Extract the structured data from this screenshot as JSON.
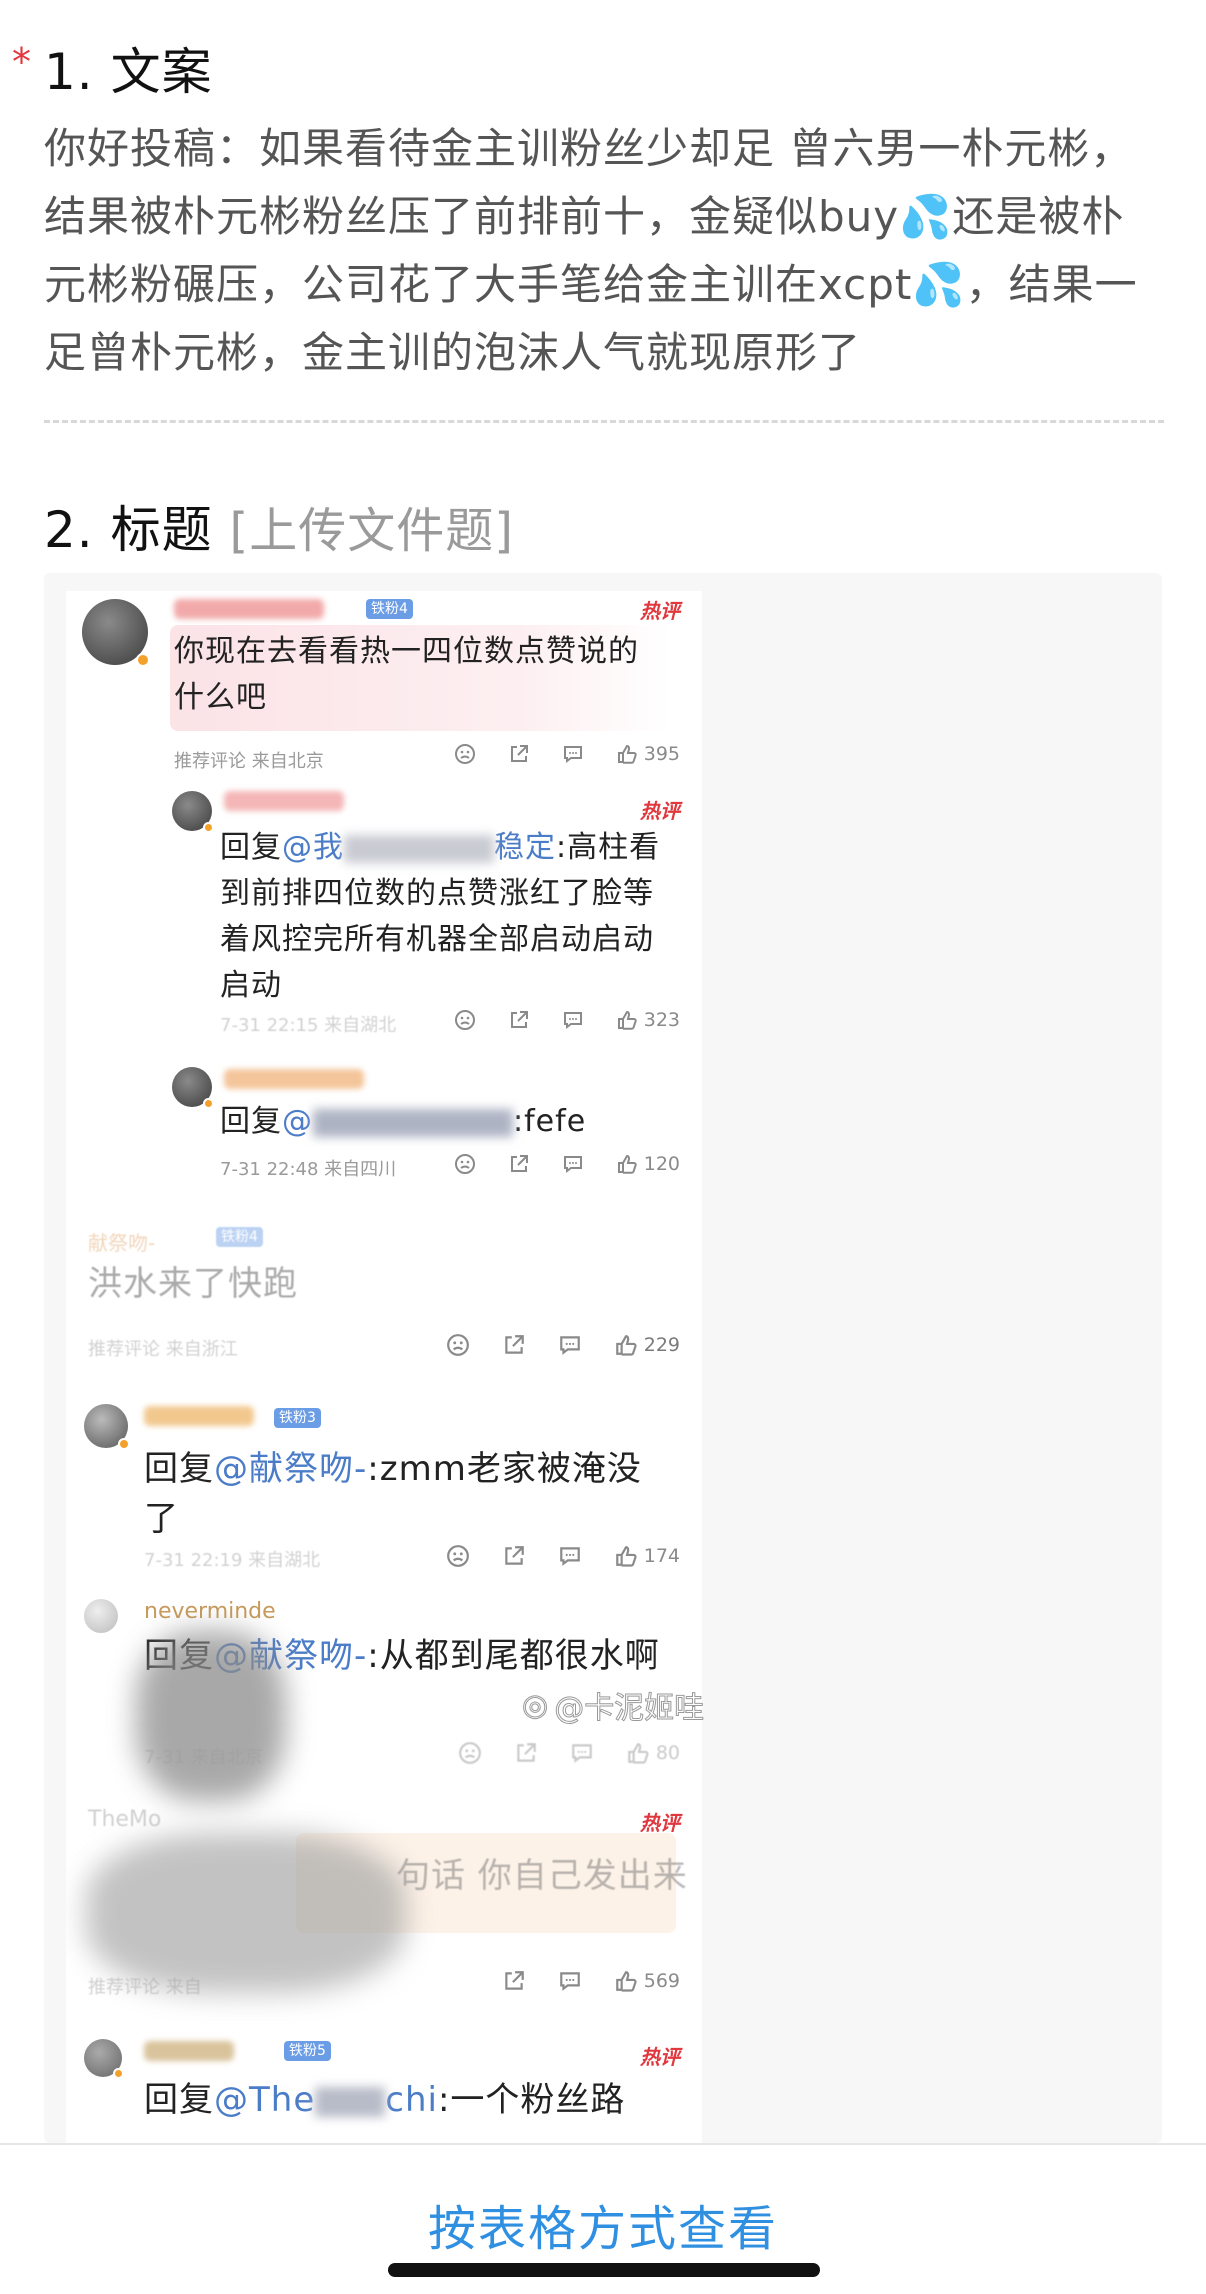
{
  "form": {
    "required_mark": "*",
    "section1": {
      "title": "1. 文案",
      "body": "你好投稿：如果看待金主训粉丝少却足 曾六男一朴元彬，结果被朴元彬粉丝压了前排前十，金疑似buy💦还是被朴元彬粉碾压，公司花了大手笔给金主训在xcpt💦，结果一足曾朴元彬，金主训的泡沫人气就现原形了"
    },
    "section2": {
      "title": "2. 标题",
      "hint": "[上传文件题]"
    }
  },
  "screenshot": {
    "watermark": "@卡泥姬哇",
    "comments": [
      {
        "badge": "铁粉4",
        "hot": "热评",
        "text": "你现在去看看热一四位数点赞说的什么吧",
        "meta": "推荐评论  来自北京",
        "likes": "395"
      },
      {
        "hot": "热评",
        "reply": "回复",
        "mention": "@我",
        "mention_tail": "稳定",
        "text": ":高柱看到前排四位数的点赞涨红了脸等着风控完所有机器全部启动启动启动",
        "meta": "7-31 22:15  来自湖北",
        "likes": "323"
      },
      {
        "reply": "回复",
        "mention": "@",
        "text": ":fefe",
        "meta": "7-31 22:48  来自四川",
        "likes": "120"
      },
      {
        "user": "献祭吻-",
        "badge": "铁粉4",
        "text": "洪水来了快跑",
        "meta": "推荐评论  来自浙江",
        "likes": "229"
      },
      {
        "badge": "铁粉3",
        "reply": "回复",
        "mention": "@献祭吻-",
        "text": ":zmm老家被淹没了",
        "meta": "7-31 22:19  来自湖北",
        "likes": "174"
      },
      {
        "user": "neverminde",
        "reply": "回复",
        "mention": "@献祭吻-",
        "text": ":从都到尾都很水啊",
        "meta": "7-31  来自北京",
        "likes": "80"
      },
      {
        "user": "TheMo",
        "hot": "热评",
        "text": "句话 你自己发出来",
        "meta": "推荐评论  来自",
        "likes": "569"
      },
      {
        "badge": "铁粉5",
        "hot": "热评",
        "reply": "回复",
        "mention": "@The",
        "mention_tail": "chi",
        "text": ":一个粉丝路"
      }
    ]
  },
  "footer": {
    "view_table": "按表格方式查看"
  }
}
